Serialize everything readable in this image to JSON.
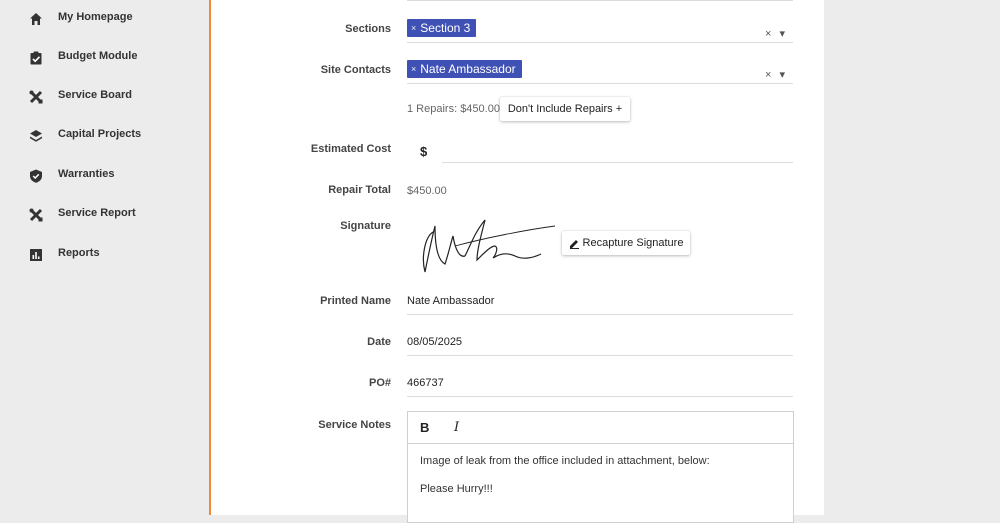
{
  "sidebar": {
    "items": [
      {
        "label": "My Homepage",
        "icon": "home-icon"
      },
      {
        "label": "Budget Module",
        "icon": "clipboard-check-icon"
      },
      {
        "label": "Service Board",
        "icon": "wrench-screwdriver-icon"
      },
      {
        "label": "Capital Projects",
        "icon": "layers-icon"
      },
      {
        "label": "Warranties",
        "icon": "shield-check-icon"
      },
      {
        "label": "Service Report",
        "icon": "wrench-screwdriver-icon"
      },
      {
        "label": "Reports",
        "icon": "bar-chart-icon"
      }
    ]
  },
  "form": {
    "sections": {
      "label": "Sections",
      "chip": "Section 3",
      "chip_remove": "×",
      "clear": "×",
      "caret": "▾"
    },
    "site_contacts": {
      "label": "Site Contacts",
      "chip": "Nate Ambassador",
      "chip_remove": "×",
      "clear": "×",
      "caret": "▾"
    },
    "repairs": {
      "summary": "1 Repairs: $450.00",
      "button": "Don't Include Repairs +"
    },
    "estimated_cost": {
      "label": "Estimated Cost",
      "currency": "$",
      "value": ""
    },
    "repair_total": {
      "label": "Repair Total",
      "value": "$450.00"
    },
    "signature": {
      "label": "Signature",
      "button": "Recapture Signature"
    },
    "printed_name": {
      "label": "Printed Name",
      "value": "Nate Ambassador"
    },
    "date": {
      "label": "Date",
      "value": "08/05/2025"
    },
    "po": {
      "label": "PO#",
      "value": "466737"
    },
    "service_notes": {
      "label": "Service Notes",
      "bold": "B",
      "italic": "I",
      "lines": [
        "Image of leak from the office included in attachment, below:",
        "Please Hurry!!!"
      ]
    }
  },
  "colors": {
    "accent": "#f08a3c",
    "chip": "#3f51b5"
  }
}
